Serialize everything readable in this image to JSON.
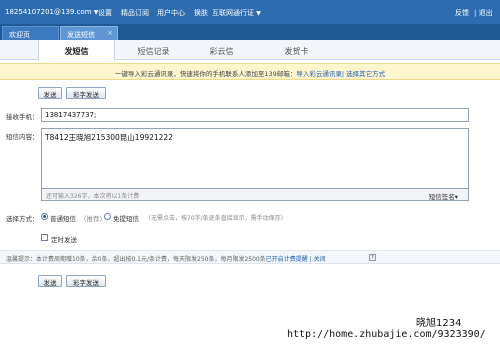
{
  "topbar": {
    "account": "18254107201@139.com",
    "settings": "设置",
    "subscription": "精品订阅",
    "user_center": "用户中心",
    "skin": "换肤",
    "interconnect": "互联网通行证",
    "feedback": "反馈",
    "exit": "| 退出"
  },
  "tabs": [
    {
      "label": "欢迎页"
    },
    {
      "label": "发送短信",
      "close": "×"
    }
  ],
  "subtabs": [
    "发短信",
    "短信记录",
    "彩云信",
    "发贺卡"
  ],
  "notice": {
    "text": "一键导入彩云通讯录，快速将你的手机联系人添加至139邮箱：",
    "link": "导入彩云通讯录",
    "link2": "| 选择其它方式"
  },
  "actions": {
    "send": "发送",
    "color_send": "彩字发送"
  },
  "form": {
    "receiver_label": "接收手机：",
    "receiver_value": "13817437737;",
    "content_label": "短信内容：",
    "content_value": "T8412王晓旭215300昆山19921222",
    "counter": "还可输入326字，本次将以1条计费",
    "signature": "短信签名",
    "signature_caret": "▾",
    "method_label": "选择方式：",
    "method_normal": "普通短信",
    "method_normal_note": "（推荐）",
    "method_free": "免提短信",
    "method_free_note": "（无需点击，按70字/条逐条直接显示，需手动保存）",
    "scheduled": "定时发送"
  },
  "tips": {
    "text": "温馨提示：本计费周期赠10条，余0条，超出按0.1元/条计费，每天限发250条，每月限发2500条",
    "link": "已开启计费提醒",
    "sep": "| 关闭",
    "help": "?"
  },
  "watermark": {
    "line1": "晓旭1234",
    "line2": "http://home.zhubajie.com/9323390/"
  }
}
